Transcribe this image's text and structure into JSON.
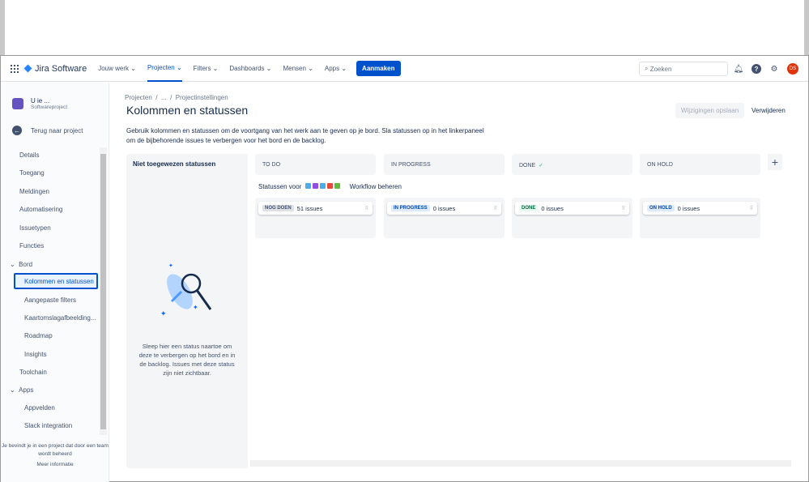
{
  "nav": {
    "product": "Jira Software",
    "items": [
      "Jouw werk",
      "Projecten",
      "Filters",
      "Dashboards",
      "Mensen",
      "Apps"
    ],
    "active": "Projecten",
    "create": "Aanmaken",
    "search_placeholder": "Zoeken",
    "avatar": "DS"
  },
  "sidebar": {
    "project_name": "U ie ...",
    "project_type": "Softwareproject",
    "back": "Terug naar project",
    "items": [
      "Details",
      "Toegang",
      "Meldingen",
      "Automatisering",
      "Issuetypen",
      "Functies",
      "Bord",
      "Kolommen en statussen",
      "Aangepaste filters",
      "Kaartomslagafbeelding...",
      "Roadmap",
      "Insights",
      "Toolchain",
      "Apps",
      "Appvelden",
      "Slack integration"
    ],
    "footer": "Je bevindt je in een project dat door een team wordt beheerd",
    "more": "Meer informatie"
  },
  "main": {
    "breadcrumb": [
      "Projecten",
      "/",
      "...",
      "/",
      "Projectinstellingen"
    ],
    "title": "Kolommen en statussen",
    "description": "Gebruik kolommen en statussen om de voortgang van het werk aan te geven op je bord. Sla statussen op in het linkerpaneel om de bijbehorende issues te verbergen voor het bord en de backlog.",
    "save": "Wijzigingen opslaan",
    "delete": "Verwijderen",
    "unassigned_title": "Niet toegewezen statussen",
    "unassigned_text": "Sleep hier een status naartoe om deze te verbergen op het bord en in de backlog. Issues met deze status zijn niet zichtbaar.",
    "statuses_for": "Statussen voor",
    "workflow": "Workflow beheren",
    "add": "+",
    "columns": [
      {
        "name": "TO DO",
        "lozenge": "NOG DOEN",
        "count": "51 issues",
        "lozenge_bg": "#dfe1e6",
        "lozenge_fg": "#42526e"
      },
      {
        "name": "IN PROGRESS",
        "lozenge": "IN PROGRESS",
        "count": "0 issues",
        "lozenge_bg": "#deebff",
        "lozenge_fg": "#0747a6"
      },
      {
        "name": "DONE",
        "check": "✓",
        "lozenge": "DONE",
        "count": "0 issues",
        "lozenge_bg": "#e3fcef",
        "lozenge_fg": "#006644"
      },
      {
        "name": "ON HOLD",
        "lozenge": "ON HOLD",
        "count": "0 issues",
        "lozenge_bg": "#deebff",
        "lozenge_fg": "#0747a6"
      }
    ],
    "issue_type_colors": [
      "#4bade8",
      "#904ee2",
      "#4bade8",
      "#e5493a",
      "#63ba3c"
    ]
  }
}
